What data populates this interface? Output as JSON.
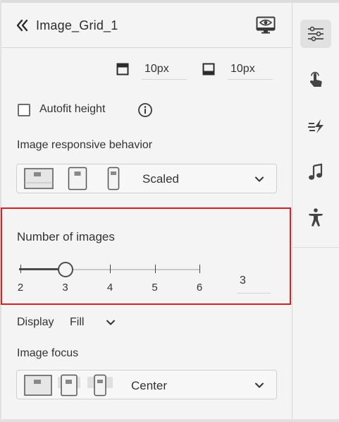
{
  "header": {
    "title": "Image_Grid_1",
    "collapse_icon": "double-chevron-left-icon",
    "preview_icon": "monitor-eye-icon"
  },
  "padding": {
    "top_value": "10px",
    "bottom_value": "10px"
  },
  "autofit": {
    "label": "Autofit height",
    "checked": false
  },
  "responsive": {
    "label": "Image responsive behavior",
    "selected": "Scaled"
  },
  "number_of_images": {
    "label": "Number of images",
    "ticks": [
      "2",
      "3",
      "4",
      "5",
      "6"
    ],
    "min": 2,
    "max": 6,
    "value": 3,
    "field_value": "3"
  },
  "display": {
    "label": "Display",
    "value": "Fill"
  },
  "image_focus": {
    "label": "Image focus",
    "selected": "Center"
  },
  "rail": {
    "items": [
      {
        "icon": "sliders-icon",
        "active": true
      },
      {
        "icon": "interaction-hand-icon",
        "active": false
      },
      {
        "icon": "animation-icon",
        "active": false
      },
      {
        "icon": "music-note-icon",
        "active": false
      },
      {
        "icon": "accessibility-icon",
        "active": false
      }
    ]
  },
  "colors": {
    "highlight": "#e0201f",
    "panel_bg": "#f4f4f4",
    "active_rail_bg": "#e1e1e1"
  }
}
